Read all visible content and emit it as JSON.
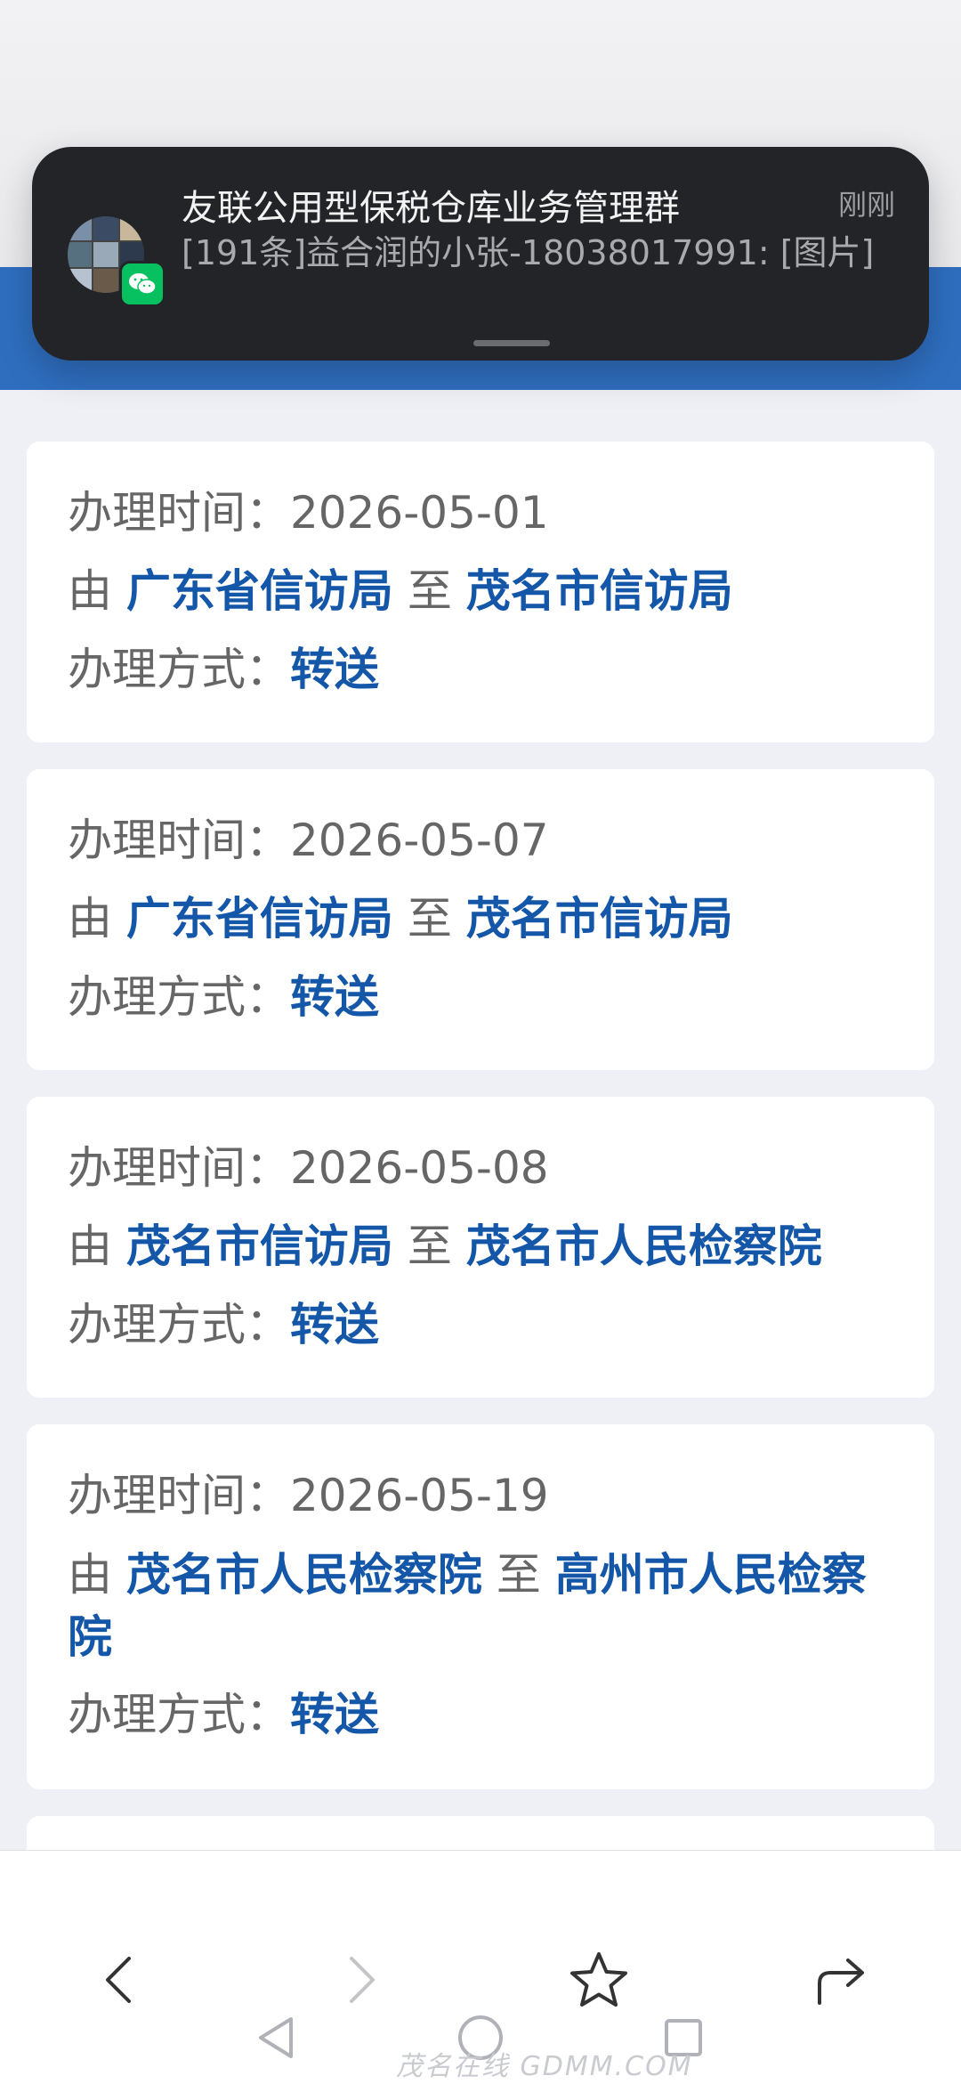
{
  "notification": {
    "title": "友联公用型保税仓库业务管理群",
    "time": "刚刚",
    "message": "[191条]益合润的小张-18038017991: [图片]",
    "app_icon": "wechat-icon",
    "avatar_colors": [
      "#7a8fa8",
      "#3b4b63",
      "#c9b79c",
      "#567080",
      "#9aa9b8",
      "#2d3a4e",
      "#b6c2cf",
      "#6a5a4a",
      "#8899aa"
    ]
  },
  "labels": {
    "time_label": "办理时间：",
    "from_word": "由",
    "to_word": "至",
    "method_label": "办理方式："
  },
  "records": [
    {
      "date": "2026-05-01",
      "from": "广东省信访局",
      "to": "茂名市信访局",
      "method": "转送"
    },
    {
      "date": "2026-05-07",
      "from": "广东省信访局",
      "to": "茂名市信访局",
      "method": "转送"
    },
    {
      "date": "2026-05-08",
      "from": "茂名市信访局",
      "to": "茂名市人民检察院",
      "method": "转送"
    },
    {
      "date": "2026-05-19",
      "from": "茂名市人民检察院",
      "to": "高州市人民检察院",
      "method": "转送"
    }
  ],
  "browser_toolbar": {
    "back": "back-arrow-icon",
    "forward": "forward-arrow-icon",
    "bookmark": "star-icon",
    "share": "share-icon"
  },
  "system_nav": {
    "back": "triangle-back-icon",
    "home": "circle-home-icon",
    "recents": "square-recents-icon"
  },
  "watermark": "茂名在线 GDMM.COM",
  "colors": {
    "accent_blue": "#1457a8",
    "header_blue": "#2f6ebf",
    "wechat_green": "#07c160"
  }
}
